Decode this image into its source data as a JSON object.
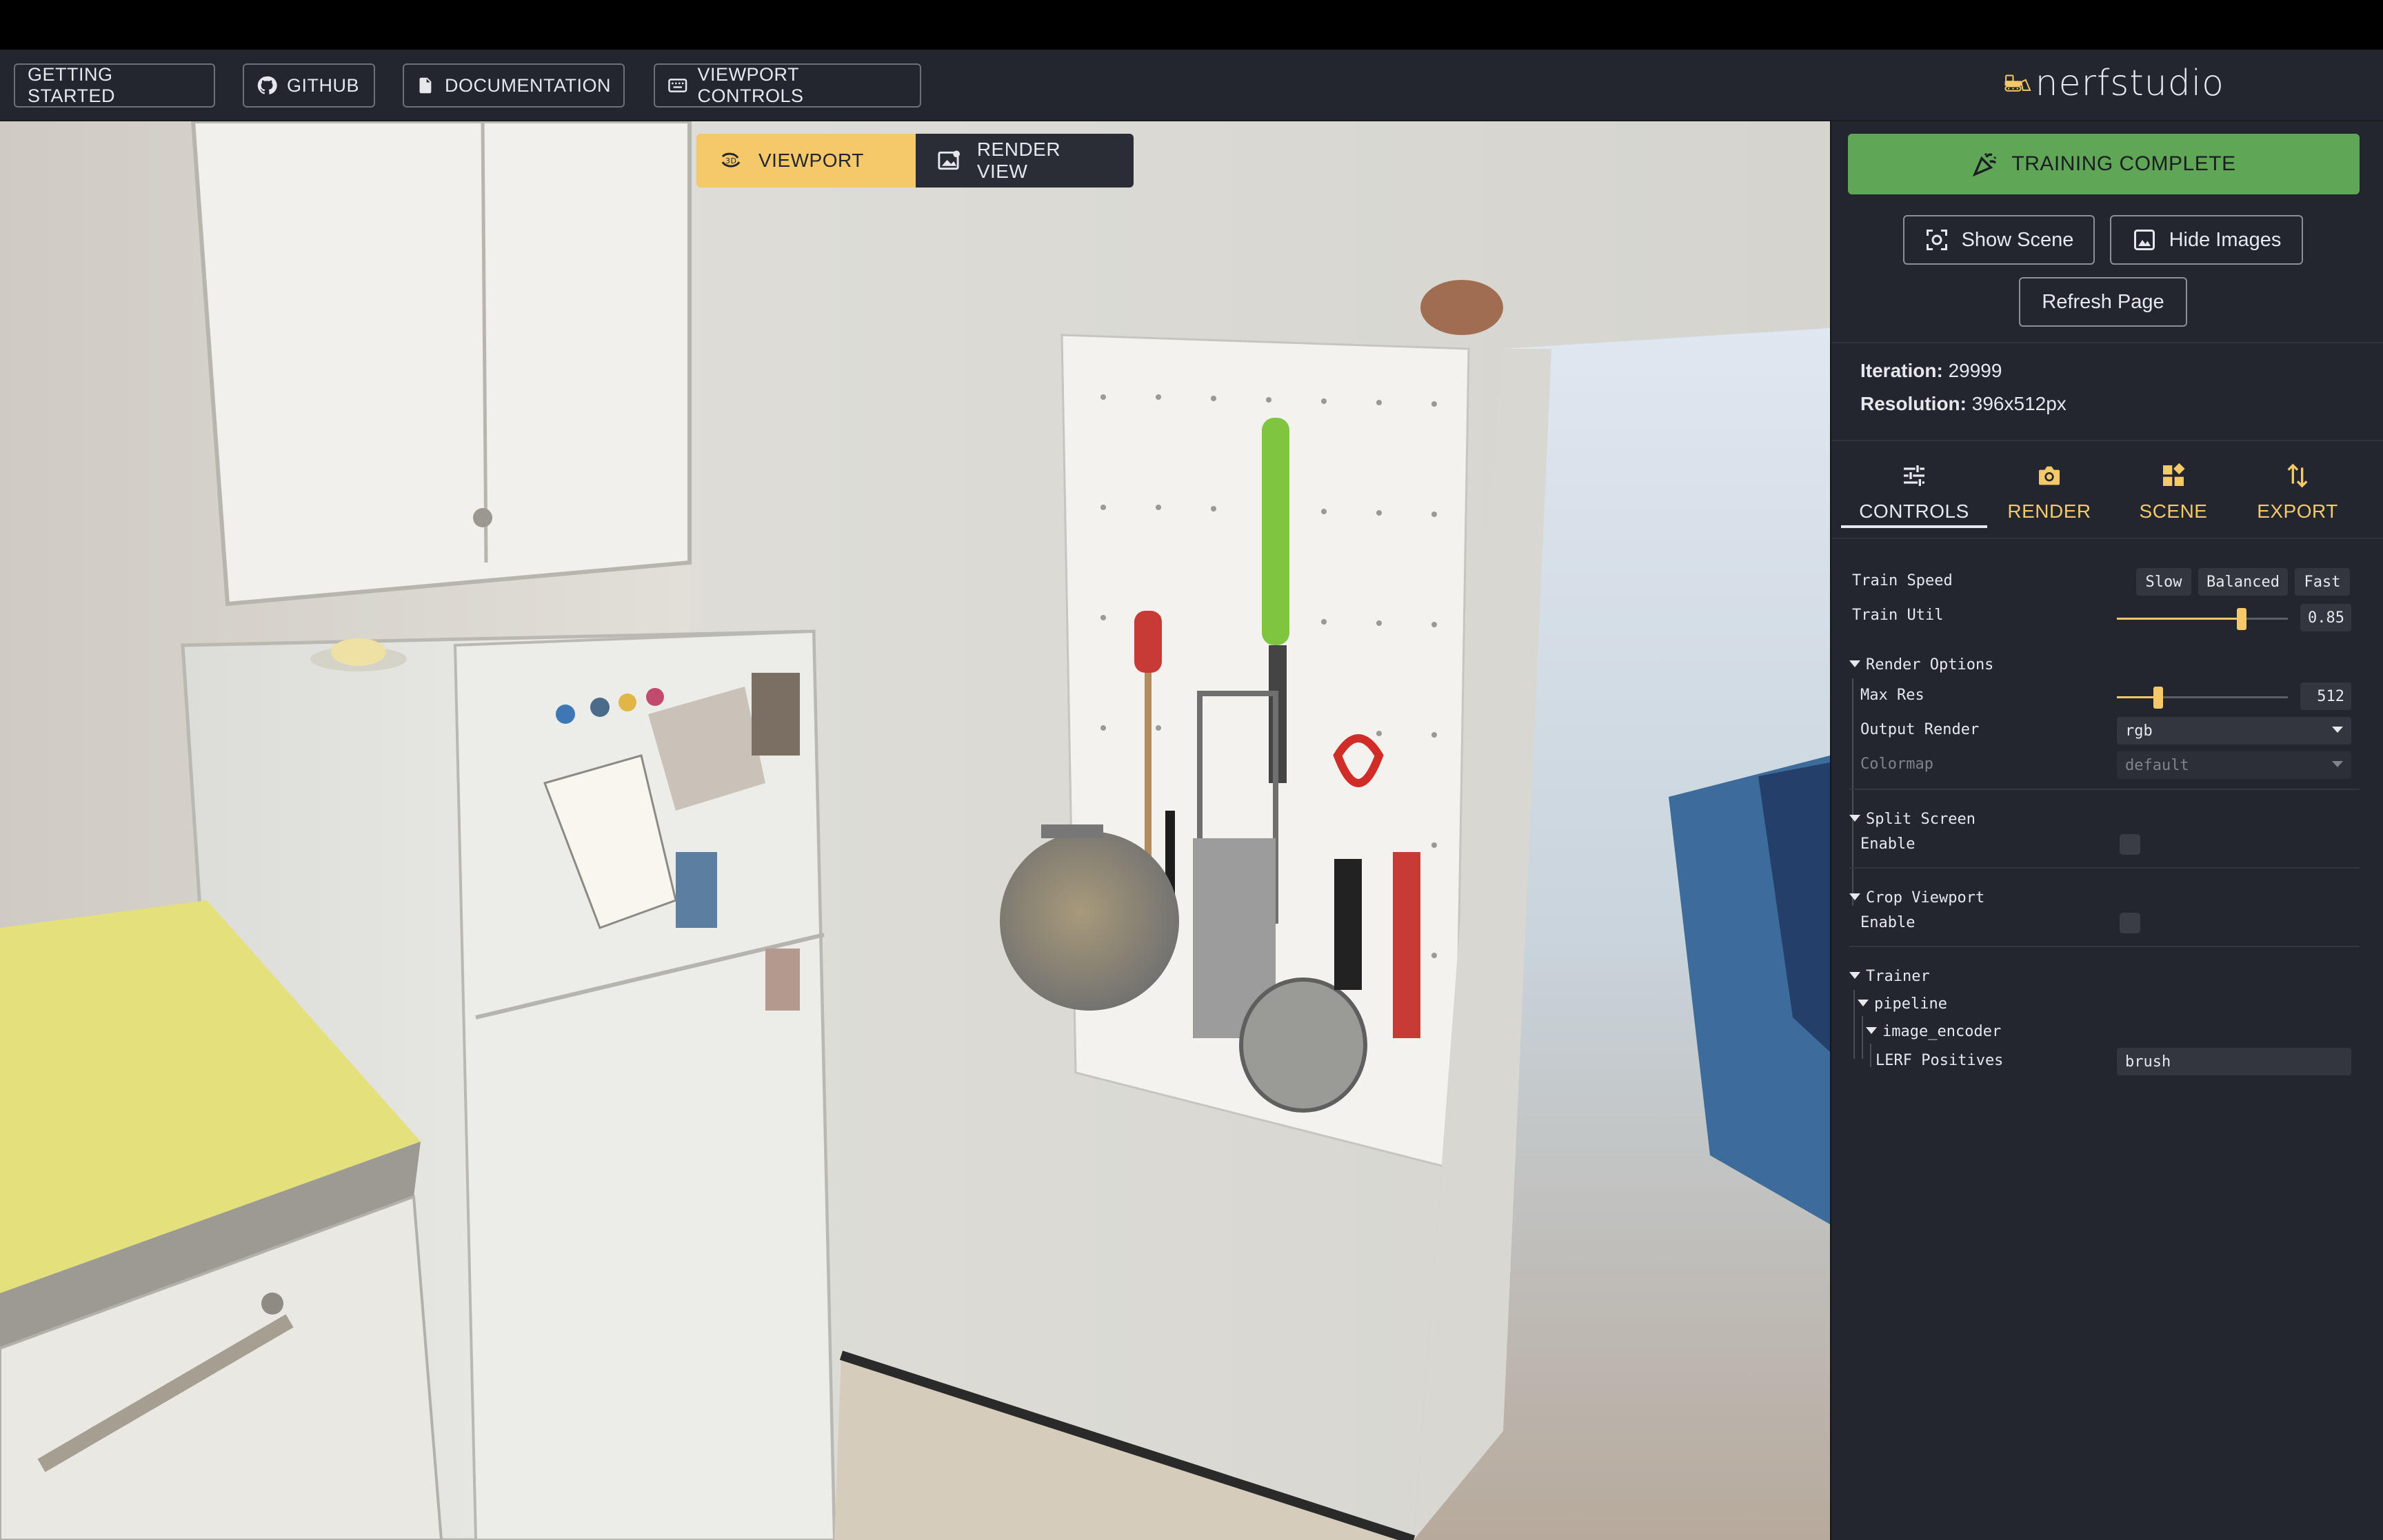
{
  "header": {
    "buttons": [
      {
        "label": "GETTING STARTED",
        "icon": "none"
      },
      {
        "label": "GITHUB",
        "icon": "github-icon"
      },
      {
        "label": "DOCUMENTATION",
        "icon": "document-icon"
      },
      {
        "label": "VIEWPORT CONTROLS",
        "icon": "keyboard-icon"
      }
    ],
    "logo_text": "nerfstudio",
    "logo_icon": "bulldozer-icon"
  },
  "viewport": {
    "toggle": {
      "viewport_label": "VIEWPORT",
      "render_view_label": "RENDER VIEW",
      "active": "viewport"
    },
    "scene": "3D render of kitchen with refrigerator, pegboard with utensils, and doorway"
  },
  "panel": {
    "training_label": "TRAINING COMPLETE",
    "show_scene_label": "Show Scene",
    "hide_images_label": "Hide Images",
    "refresh_label": "Refresh Page",
    "iteration_label": "Iteration:",
    "iteration_value": "29999",
    "resolution_label": "Resolution:",
    "resolution_value": "396x512px",
    "tabs": [
      {
        "label": "CONTROLS",
        "icon": "sliders-icon"
      },
      {
        "label": "RENDER",
        "icon": "camera-icon"
      },
      {
        "label": "SCENE",
        "icon": "grid-icon"
      },
      {
        "label": "EXPORT",
        "icon": "arrows-icon"
      }
    ],
    "active_tab": "CONTROLS",
    "controls": {
      "train_speed_label": "Train Speed",
      "speed_options": [
        "Slow",
        "Balanced",
        "Fast"
      ],
      "train_util_label": "Train Util",
      "train_util_value": "0.85",
      "train_util_fraction": 0.85,
      "render_options_label": "Render Options",
      "max_res_label": "Max Res",
      "max_res_value": "512",
      "max_res_fraction": 0.24,
      "output_render_label": "Output Render",
      "output_render_value": "rgb",
      "colormap_label": "Colormap",
      "colormap_value": "default",
      "split_screen_label": "Split Screen",
      "split_enable_label": "Enable",
      "crop_viewport_label": "Crop Viewport",
      "crop_enable_label": "Enable",
      "trainer_label": "Trainer",
      "pipeline_label": "pipeline",
      "image_encoder_label": "image_encoder",
      "lerf_positives_label": "LERF Positives",
      "lerf_positives_value": "brush"
    },
    "colors": {
      "accent": "#f5c96a",
      "training_green": "#5fa656",
      "panel_bg": "#23262e"
    }
  }
}
